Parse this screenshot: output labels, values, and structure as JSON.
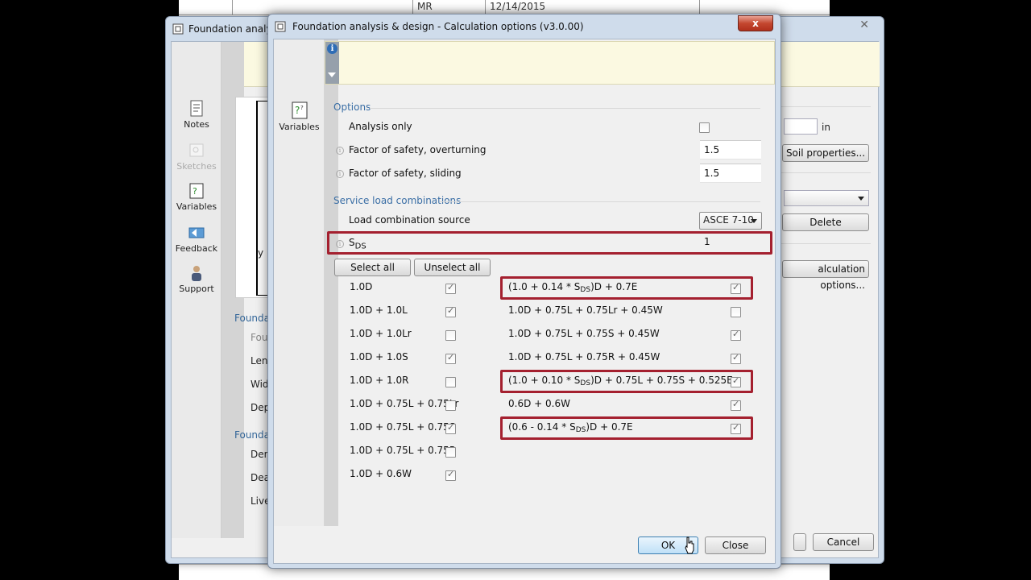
{
  "background_doc": {
    "cell1": "MR",
    "cell2": "12/14/2015"
  },
  "back_window": {
    "title": "Foundation analysis",
    "sidebar": [
      {
        "label": "Notes",
        "icon": "notes-icon",
        "enabled": true
      },
      {
        "label": "Sketches",
        "icon": "sketches-icon",
        "enabled": false
      },
      {
        "label": "Variables",
        "icon": "variables-icon",
        "enabled": true
      },
      {
        "label": "Feedback",
        "icon": "feedback-icon",
        "enabled": true
      },
      {
        "label": "Support",
        "icon": "support-icon",
        "enabled": true
      }
    ],
    "diagram_axis": "y",
    "labels": [
      "Foundatio",
      "Foun",
      "Lengt",
      "Width",
      "Depth",
      "Foundatio",
      "Densi",
      "Dead",
      "Live l"
    ],
    "unit": "in",
    "soil_button": "Soil properties...",
    "delete_button": "Delete",
    "calc_options_button": "alculation options...",
    "cancel_button": "Cancel"
  },
  "dialog": {
    "title": "Foundation analysis & design - Calculation options (v3.0.00)",
    "close_label": "x",
    "sidebar_variables": "Variables",
    "options": {
      "section": "Options",
      "analysis_only_label": "Analysis only",
      "analysis_only_checked": false,
      "fs_overturning_label": "Factor of safety, overturning",
      "fs_overturning_value": "1.5",
      "fs_sliding_label": "Factor of safety, sliding",
      "fs_sliding_value": "1.5"
    },
    "service": {
      "section": "Service load combinations",
      "source_label": "Load combination source",
      "source_value": "ASCE 7-10",
      "sds_label_main": "S",
      "sds_label_sub": "DS",
      "sds_value": "1",
      "select_all": "Select all",
      "unselect_all": "Unselect all"
    },
    "left_combos": [
      {
        "label": "1.0D",
        "checked": true
      },
      {
        "label": "1.0D + 1.0L",
        "checked": true
      },
      {
        "label": "1.0D + 1.0Lr",
        "checked": false
      },
      {
        "label": "1.0D + 1.0S",
        "checked": true
      },
      {
        "label": "1.0D + 1.0R",
        "checked": false
      },
      {
        "label": "1.0D + 0.75L + 0.75Lr",
        "checked": false
      },
      {
        "label": "1.0D + 0.75L + 0.75S",
        "checked": true
      },
      {
        "label": "1.0D + 0.75L + 0.75R",
        "checked": false
      },
      {
        "label": "1.0D + 0.6W",
        "checked": true
      }
    ],
    "right_combos": [
      {
        "pre": "(1.0 + 0.14 * S",
        "sub": "DS",
        "post": ")D + 0.7E",
        "checked": true,
        "highlighted": true
      },
      {
        "pre": "1.0D + 0.75L + 0.75Lr + 0.45W",
        "sub": "",
        "post": "",
        "checked": false,
        "highlighted": false
      },
      {
        "pre": "1.0D + 0.75L + 0.75S + 0.45W",
        "sub": "",
        "post": "",
        "checked": true,
        "highlighted": false
      },
      {
        "pre": "1.0D + 0.75L + 0.75R + 0.45W",
        "sub": "",
        "post": "",
        "checked": true,
        "highlighted": false
      },
      {
        "pre": "(1.0 + 0.10 * S",
        "sub": "DS",
        "post": ")D + 0.75L + 0.75S + 0.525E",
        "checked": true,
        "highlighted": true
      },
      {
        "pre": "0.6D + 0.6W",
        "sub": "",
        "post": "",
        "checked": true,
        "highlighted": false
      },
      {
        "pre": "(0.6 - 0.14 * S",
        "sub": "DS",
        "post": ")D + 0.7E",
        "checked": true,
        "highlighted": true
      }
    ],
    "ok_button": "OK",
    "close_button": "Close"
  },
  "colors": {
    "highlight_box": "#a4202f",
    "section_header": "#3a6ea5",
    "info_bar": "#fbf9e1"
  }
}
